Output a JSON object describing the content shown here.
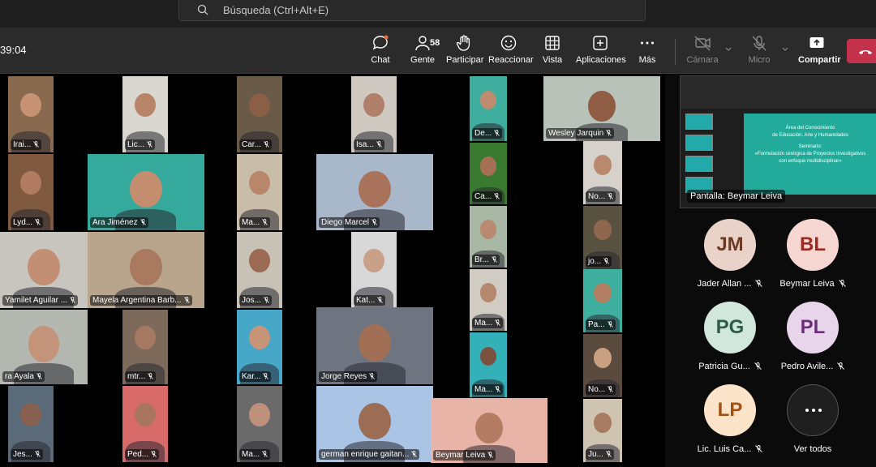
{
  "search": {
    "placeholder": "Búsqueda (Ctrl+Alt+E)"
  },
  "meeting": {
    "timer": "39:04"
  },
  "toolbar": {
    "chat": "Chat",
    "people": "Gente",
    "people_count": "58",
    "raise": "Participar",
    "react": "Reaccionar",
    "view": "Vista",
    "apps": "Aplicaciones",
    "more": "Más",
    "camera": "Cámara",
    "mic": "Micro",
    "share": "Compartir"
  },
  "colors": {
    "accent": "#c4314b",
    "toolbar_bg": "#2b2b2b",
    "notification": "#e8684a"
  },
  "participants": [
    {
      "name": "Irai...",
      "bg": "#8a6a4f",
      "face": "#c79273"
    },
    {
      "name": "Lic...",
      "bg": "#d9d7cf",
      "face": "#b88568"
    },
    {
      "name": "Car...",
      "bg": "#6a5a48",
      "face": "#8a5f45"
    },
    {
      "name": "Isa...",
      "bg": "#cfc9c2",
      "face": "#b0806a"
    },
    {
      "name": "De...",
      "bg": "#3fae9e",
      "face": "#c08c70"
    },
    {
      "name": "Wesley Jarquin",
      "bg": "#b9c2b8",
      "face": "#8f5c44"
    },
    {
      "name": "Lyd...",
      "bg": "#7f5a3f",
      "face": "#b07b5f"
    },
    {
      "name": "Ara Jiménez",
      "bg": "#34a99c",
      "face": "#c48d6e"
    },
    {
      "name": "Ma...",
      "bg": "#c9bca8",
      "face": "#b8866a"
    },
    {
      "name": "Diego Marcel",
      "bg": "#a8b7c9",
      "face": "#a8735a"
    },
    {
      "name": "Ca...",
      "bg": "#3a7a30",
      "face": "#a56f55"
    },
    {
      "name": "No...",
      "bg": "#d6d2cb",
      "face": "#bb8a6e"
    },
    {
      "name": "Yamilet Aguilar ...",
      "bg": "#c8c5be",
      "face": "#c28f75"
    },
    {
      "name": "Mayela Argentina Barb...",
      "bg": "#b9a48c",
      "face": "#a97a60"
    },
    {
      "name": "Jos...",
      "bg": "#c8c2b6",
      "face": "#9c6a52"
    },
    {
      "name": "Kat...",
      "bg": "#d8d8d8",
      "face": "#c9a088"
    },
    {
      "name": "Br...",
      "bg": "#a8b7a3",
      "face": "#b88a70"
    },
    {
      "name": "jo...",
      "bg": "#5a5240",
      "face": "#8f664e"
    },
    {
      "name": "Ma...",
      "bg": "#d0ccc4",
      "face": "#b5876d"
    },
    {
      "name": "Pa...",
      "bg": "#3fb0a0",
      "face": "#b38064"
    },
    {
      "name": "ra Ayala",
      "bg": "#b4b6b0",
      "face": "#c3947a"
    },
    {
      "name": "mtr...",
      "bg": "#7d6a5a",
      "face": "#a67a62"
    },
    {
      "name": "Kar...",
      "bg": "#47a7c9",
      "face": "#c89478"
    },
    {
      "name": "Jorge Reyes",
      "bg": "#6e7580",
      "face": "#a06f56"
    },
    {
      "name": "Ma...",
      "bg": "#33b0b8",
      "face": "#7a5240"
    },
    {
      "name": "No...",
      "bg": "#5a4b3e",
      "face": "#c9a080"
    },
    {
      "name": "Jes...",
      "bg": "#5b6a78",
      "face": "#876050"
    },
    {
      "name": "Ped...",
      "bg": "#d96a6a",
      "face": "#a87560"
    },
    {
      "name": "Ma...",
      "bg": "#6a6a6a",
      "face": "#bf907a"
    },
    {
      "name": "german enrique gaitan...",
      "bg": "#a9c4e4",
      "face": "#9c6d55"
    },
    {
      "name": "Beymar  Leiva",
      "bg": "#e8b4a8",
      "face": "#b47c62"
    },
    {
      "name": "Ju...",
      "bg": "#cfc3b2",
      "face": "#a77a62"
    }
  ],
  "share": {
    "label": "Pantalla: Beymar Leiva",
    "slide_lines": [
      "Área del Conocimiento",
      "de Educación, Arte y Humanidades",
      "Seminario:",
      "«Formulación sinérgica de Proyectos Investigativos",
      "con enfoque multidisciplinar»"
    ]
  },
  "roster": [
    {
      "initials": "JM",
      "name": "Jader Allan ...",
      "color": "#e9d2c7",
      "text_color": "#6b3a24"
    },
    {
      "initials": "BL",
      "name": "Beymar Leiva",
      "color": "#f5d6d0",
      "text_color": "#9a2a23"
    },
    {
      "initials": "PG",
      "name": "Patricia Gu...",
      "color": "#d1e7dc",
      "text_color": "#2f5c46"
    },
    {
      "initials": "PL",
      "name": "Pedro Avile...",
      "color": "#e8d5ec",
      "text_color": "#6a2f77"
    },
    {
      "initials": "LP",
      "name": "Lic. Luis Ca...",
      "color": "#fbe4c9",
      "text_color": "#a2520f"
    },
    {
      "initials": "",
      "name": "Ver todos",
      "color": "#1f1f1f",
      "text_color": "#ffffff"
    }
  ]
}
